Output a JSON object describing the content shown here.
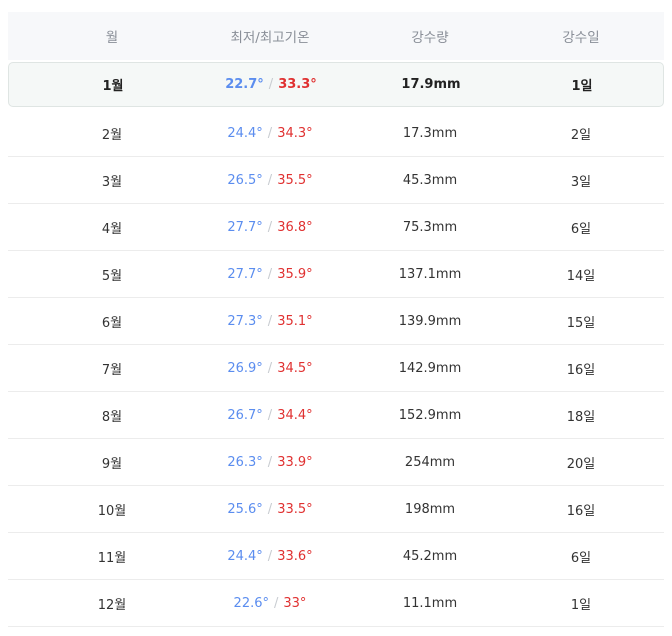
{
  "header": {
    "month": "월",
    "temp": "최저/최고기온",
    "rain": "강수량",
    "days": "강수일"
  },
  "sep": "/",
  "rows": [
    {
      "month": "1월",
      "low": "22.7°",
      "high": "33.3°",
      "rain": "17.9mm",
      "days": "1일"
    },
    {
      "month": "2월",
      "low": "24.4°",
      "high": "34.3°",
      "rain": "17.3mm",
      "days": "2일"
    },
    {
      "month": "3월",
      "low": "26.5°",
      "high": "35.5°",
      "rain": "45.3mm",
      "days": "3일"
    },
    {
      "month": "4월",
      "low": "27.7°",
      "high": "36.8°",
      "rain": "75.3mm",
      "days": "6일"
    },
    {
      "month": "5월",
      "low": "27.7°",
      "high": "35.9°",
      "rain": "137.1mm",
      "days": "14일"
    },
    {
      "month": "6월",
      "low": "27.3°",
      "high": "35.1°",
      "rain": "139.9mm",
      "days": "15일"
    },
    {
      "month": "7월",
      "low": "26.9°",
      "high": "34.5°",
      "rain": "142.9mm",
      "days": "16일"
    },
    {
      "month": "8월",
      "low": "26.7°",
      "high": "34.4°",
      "rain": "152.9mm",
      "days": "18일"
    },
    {
      "month": "9월",
      "low": "26.3°",
      "high": "33.9°",
      "rain": "254mm",
      "days": "20일"
    },
    {
      "month": "10월",
      "low": "25.6°",
      "high": "33.5°",
      "rain": "198mm",
      "days": "16일"
    },
    {
      "month": "11월",
      "low": "24.4°",
      "high": "33.6°",
      "rain": "45.2mm",
      "days": "6일"
    },
    {
      "month": "12월",
      "low": "22.6°",
      "high": "33°",
      "rain": "11.1mm",
      "days": "1일"
    }
  ],
  "highlighted_month": "1월",
  "colors": {
    "low": "#5b8def",
    "high": "#e03131",
    "highlight_bg": "#f5f8f7",
    "header_bg": "#f7f8fa"
  }
}
